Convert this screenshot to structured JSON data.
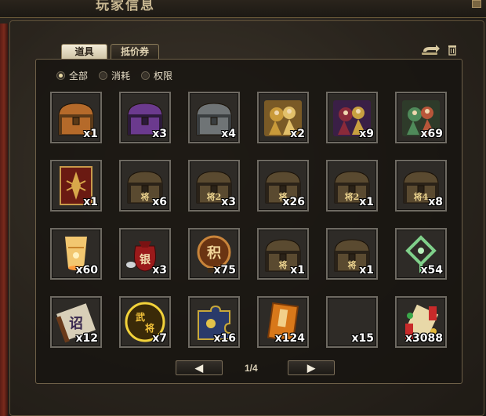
{
  "header": {
    "title": "玩家信息"
  },
  "tabs": [
    {
      "label": "道具",
      "active": true
    },
    {
      "label": "抵价券",
      "active": false
    }
  ],
  "tools": {
    "sort_icon": "return-arrow-icon",
    "delete_icon": "trash-icon"
  },
  "filters": [
    {
      "label": "全部",
      "selected": true
    },
    {
      "label": "消耗",
      "selected": false
    },
    {
      "label": "权限",
      "selected": false
    }
  ],
  "items": [
    {
      "icon": "orange-treasure-chest-icon",
      "count": "x1"
    },
    {
      "icon": "purple-treasure-chest-icon",
      "count": "x3"
    },
    {
      "icon": "silver-treasure-chest-icon",
      "count": "x4"
    },
    {
      "icon": "golden-warriors-card-icon",
      "count": "x2"
    },
    {
      "icon": "purple-warriors-card-icon",
      "count": "x9"
    },
    {
      "icon": "generals-group-card-icon",
      "count": "x69"
    },
    {
      "icon": "red-scroll-card-icon",
      "count": "x1"
    },
    {
      "icon": "general-chest-icon",
      "count": "x6"
    },
    {
      "icon": "general-chest-2-icon",
      "count": "x3"
    },
    {
      "icon": "general-chest-icon",
      "count": "x26"
    },
    {
      "icon": "general-chest-2-icon",
      "count": "x1"
    },
    {
      "icon": "general-chest-4-icon",
      "count": "x8"
    },
    {
      "icon": "sky-lantern-icon",
      "count": "x60"
    },
    {
      "icon": "silver-money-bag-icon",
      "count": "x3"
    },
    {
      "icon": "points-medal-icon",
      "count": "x75"
    },
    {
      "icon": "general-chest-icon",
      "count": "x1"
    },
    {
      "icon": "general-chest-icon",
      "count": "x1"
    },
    {
      "icon": "jade-knot-icon",
      "count": "x54"
    },
    {
      "icon": "imperial-edict-scroll-icon",
      "count": "x12"
    },
    {
      "icon": "martial-general-token-icon",
      "count": "x7"
    },
    {
      "icon": "puzzle-piece-icon",
      "count": "x16"
    },
    {
      "icon": "orange-book-icon",
      "count": "x124"
    },
    {
      "icon": "empty-slot-icon",
      "count": "x15"
    },
    {
      "icon": "firecracker-scroll-icon",
      "count": "x3088"
    }
  ],
  "chest_glyphs": [
    "将",
    "将2",
    "将",
    "将2",
    "将4",
    "将",
    "将"
  ],
  "pager": {
    "prev": "◀",
    "next": "▶",
    "page": "1/4"
  }
}
